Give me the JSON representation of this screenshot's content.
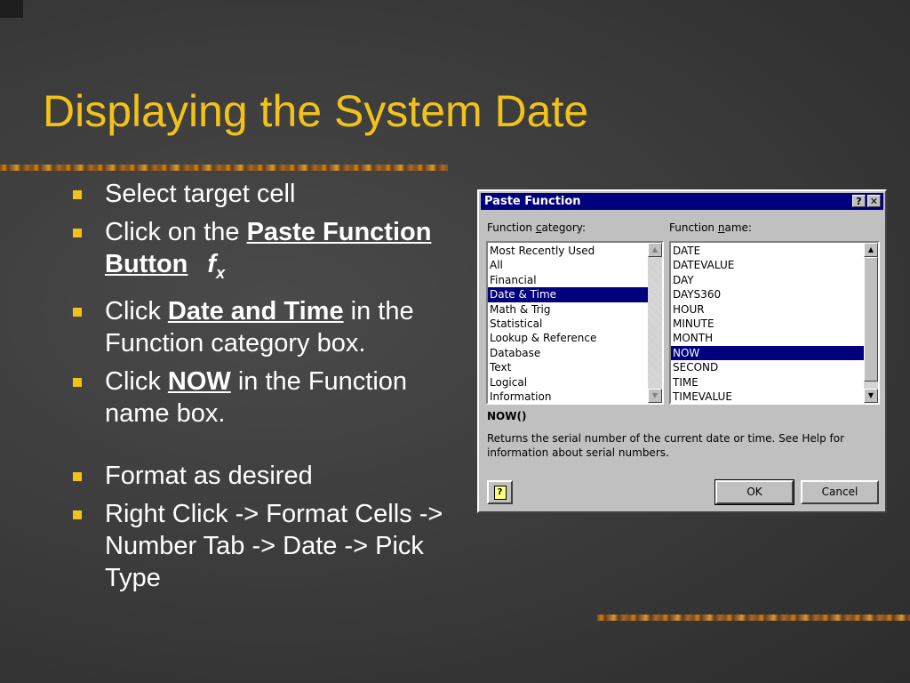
{
  "title": "Displaying the System Date",
  "bullets": {
    "b1": "Select target cell",
    "b2_pre": "Click on the ",
    "b2_bold": "Paste Function Button",
    "b2_fx": "f",
    "b2_fx_sub": "x",
    "b3_pre": "Click ",
    "b3_bold": "Date and Time",
    "b3_post": " in the Function category box.",
    "b4_pre": "Click ",
    "b4_bold": "NOW",
    "b4_post": " in the Function name box.",
    "b5": "Format as desired",
    "b6": "Right Click -> Format Cells -> Number Tab -> Date -> Pick Type"
  },
  "dialog": {
    "title": "Paste Function",
    "help_glyph": "?",
    "close_glyph": "✕",
    "category_label_pre": "Function ",
    "category_label_u": "c",
    "category_label_post": "ategory:",
    "name_label_pre": "Function ",
    "name_label_u": "n",
    "name_label_post": "ame:",
    "categories": [
      "Most Recently Used",
      "All",
      "Financial",
      "Date & Time",
      "Math & Trig",
      "Statistical",
      "Lookup & Reference",
      "Database",
      "Text",
      "Logical",
      "Information"
    ],
    "selected_category": "Date & Time",
    "functions": [
      "DATE",
      "DATEVALUE",
      "DAY",
      "DAYS360",
      "HOUR",
      "MINUTE",
      "MONTH",
      "NOW",
      "SECOND",
      "TIME",
      "TIMEVALUE"
    ],
    "selected_function": "NOW",
    "syntax": "NOW()",
    "description": "Returns the serial number of the current date or time. See Help for information about serial numbers.",
    "ok_label": "OK",
    "cancel_label": "Cancel",
    "help_button_glyph": "?"
  },
  "colors": {
    "title": "#f2c21b",
    "bullet": "#f2c21b",
    "selection": "#00007e"
  }
}
